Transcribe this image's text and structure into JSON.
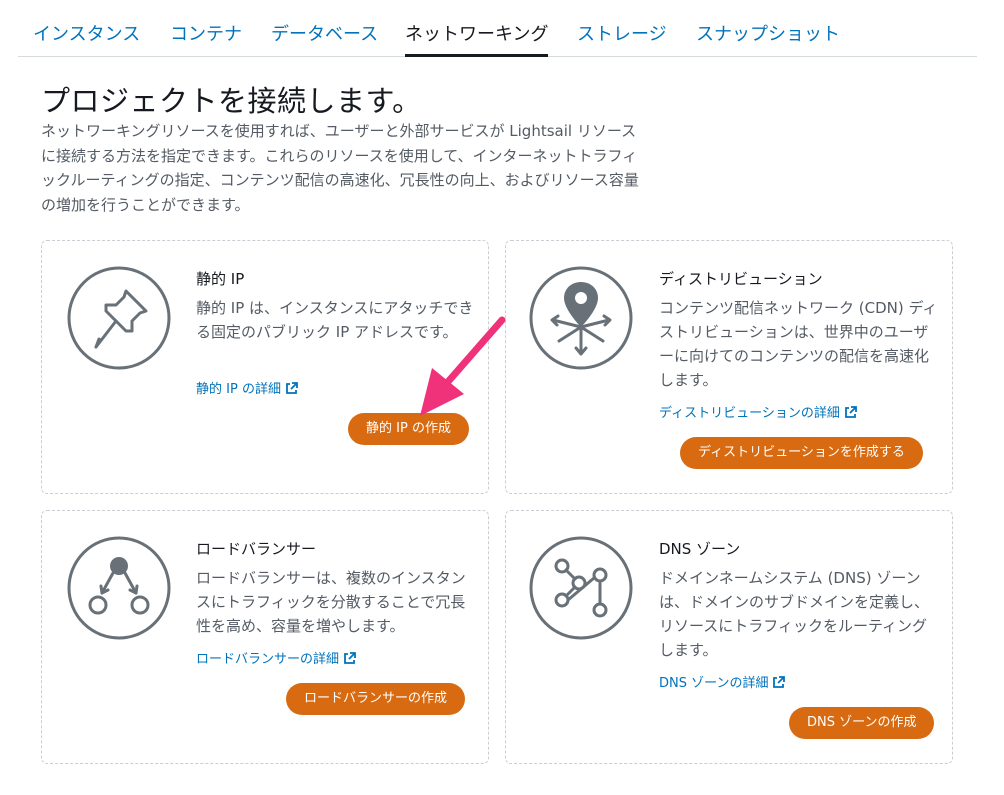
{
  "tabs": [
    {
      "label": "インスタンス",
      "active": false
    },
    {
      "label": "コンテナ",
      "active": false
    },
    {
      "label": "データベース",
      "active": false
    },
    {
      "label": "ネットワーキング",
      "active": true
    },
    {
      "label": "ストレージ",
      "active": false
    },
    {
      "label": "スナップショット",
      "active": false
    }
  ],
  "header": {
    "title": "プロジェクトを接続します。",
    "description": "ネットワーキングリソースを使用すれば、ユーザーと外部サービスが Lightsail リソースに接続する方法を指定できます。これらのリソースを使用して、インターネットトラフィックルーティングの指定、コンテンツ配信の高速化、冗長性の向上、およびリソース容量の増加を行うことができます。"
  },
  "cards": {
    "static_ip": {
      "icon": "pushpin-icon",
      "title": "静的 IP",
      "description": "静的 IP は、インスタンスにアタッチできる固定のパブリック IP アドレスです。",
      "link": "静的 IP の詳細",
      "button": "静的 IP の作成"
    },
    "distribution": {
      "icon": "map-pin-arrows-icon",
      "title": "ディストリビューション",
      "description": "コンテンツ配信ネットワーク (CDN) ディストリビューションは、世界中のユーザーに向けてのコンテンツの配信を高速化します。",
      "link": "ディストリビューションの詳細",
      "button": "ディストリビューションを作成する"
    },
    "load_balancer": {
      "icon": "load-balancer-icon",
      "title": "ロードバランサー",
      "description": "ロードバランサーは、複数のインスタンスにトラフィックを分散することで冗長性を高め、容量を増やします。",
      "link": "ロードバランサーの詳細",
      "button": "ロードバランサーの作成"
    },
    "dns_zone": {
      "icon": "dns-nodes-icon",
      "title": "DNS ゾーン",
      "description": "ドメインネームシステム (DNS) ゾーンは、ドメインのサブドメインを定義し、リソースにトラフィックをルーティングします。",
      "link": "DNS ゾーンの詳細",
      "button": "DNS ゾーンの作成"
    }
  },
  "colors": {
    "link": "#0073bb",
    "button": "#d86b11",
    "annotation_arrow": "#f0327a",
    "icon_stroke": "#687078"
  }
}
